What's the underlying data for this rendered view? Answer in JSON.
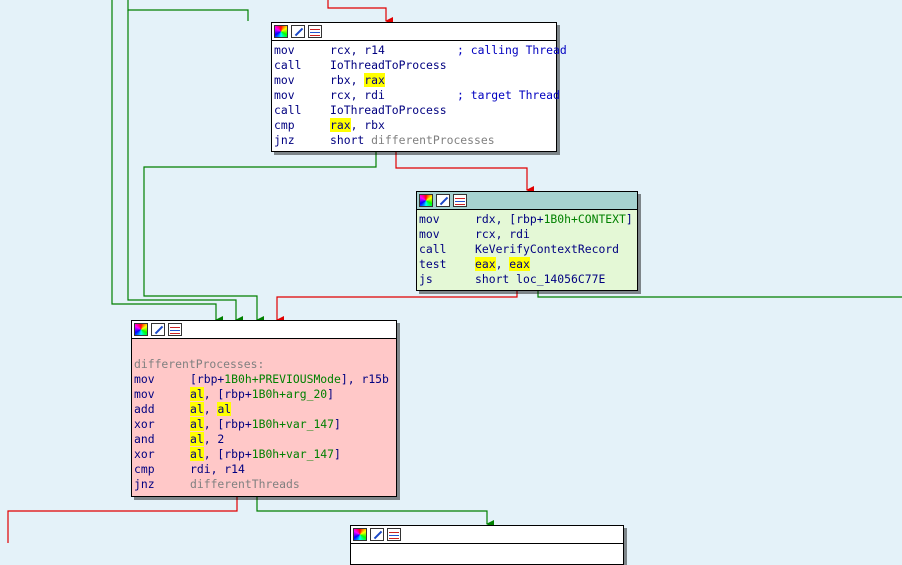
{
  "colors": {
    "background": "#e4f2f9",
    "block_white": "#ffffff",
    "block_green": "#e4f8d6",
    "block_header_green": "#a6d2d0",
    "block_red": "#ffc8c8",
    "edge_true": "#008000",
    "edge_false": "#e00000",
    "highlight": "#ffff00"
  },
  "blocks": {
    "b1": {
      "header_icons": [
        "color-palette-icon",
        "edit-pencil-icon",
        "graph-view-icon"
      ],
      "lines": [
        {
          "mn": "mov",
          "ops": [
            {
              "t": "rcx, r14"
            }
          ],
          "comment": "; calling Thread"
        },
        {
          "mn": "call",
          "ops": [
            {
              "t": "IoThreadToProcess"
            }
          ]
        },
        {
          "mn": "mov",
          "ops": [
            {
              "t": "rbx, "
            },
            {
              "t": "rax",
              "hl": true
            }
          ]
        },
        {
          "mn": "mov",
          "ops": [
            {
              "t": "rcx, rdi"
            }
          ],
          "comment": "; target Thread"
        },
        {
          "mn": "call",
          "ops": [
            {
              "t": "IoThreadToProcess"
            }
          ]
        },
        {
          "mn": "cmp",
          "ops": [
            {
              "t": "rax",
              "hl": true
            },
            {
              "t": ", rbx"
            }
          ]
        },
        {
          "mn": "jnz",
          "ops": [
            {
              "t": "short "
            },
            {
              "t": "differentProcesses",
              "c": "gray"
            }
          ]
        }
      ]
    },
    "b2": {
      "header_icons": [
        "color-palette-icon",
        "edit-pencil-icon",
        "graph-view-icon"
      ],
      "lines": [
        {
          "mn": "mov",
          "ops": [
            {
              "t": "rdx, [rbp+"
            },
            {
              "t": "1B0h+CONTEXT",
              "c": "green"
            },
            {
              "t": "]"
            }
          ]
        },
        {
          "mn": "mov",
          "ops": [
            {
              "t": "rcx, rdi"
            }
          ]
        },
        {
          "mn": "call",
          "ops": [
            {
              "t": "KeVerifyContextRecord"
            }
          ]
        },
        {
          "mn": "test",
          "ops": [
            {
              "t": "eax",
              "hl": true
            },
            {
              "t": ", "
            },
            {
              "t": "eax",
              "hl": true
            }
          ]
        },
        {
          "mn": "js",
          "ops": [
            {
              "t": "short loc_14056C77E"
            }
          ]
        }
      ]
    },
    "b3": {
      "header_icons": [
        "color-palette-icon",
        "edit-pencil-icon",
        "graph-view-icon"
      ],
      "label": "differentProcesses:",
      "lines": [
        {
          "mn": "mov",
          "ops": [
            {
              "t": "[rbp+"
            },
            {
              "t": "1B0h+PREVIOUSMode",
              "c": "green"
            },
            {
              "t": "], r15b"
            }
          ]
        },
        {
          "mn": "mov",
          "ops": [
            {
              "t": "al",
              "hl": true
            },
            {
              "t": ", [rbp+"
            },
            {
              "t": "1B0h+arg_20",
              "c": "green"
            },
            {
              "t": "]"
            }
          ]
        },
        {
          "mn": "add",
          "ops": [
            {
              "t": "al",
              "hl": true
            },
            {
              "t": ", "
            },
            {
              "t": "al",
              "hl": true
            }
          ]
        },
        {
          "mn": "xor",
          "ops": [
            {
              "t": "al",
              "hl": true
            },
            {
              "t": ", [rbp+"
            },
            {
              "t": "1B0h+var_147",
              "c": "green"
            },
            {
              "t": "]"
            }
          ]
        },
        {
          "mn": "and",
          "ops": [
            {
              "t": "al",
              "hl": true
            },
            {
              "t": ", 2"
            }
          ]
        },
        {
          "mn": "xor",
          "ops": [
            {
              "t": "al",
              "hl": true
            },
            {
              "t": ", [rbp+"
            },
            {
              "t": "1B0h+var_147",
              "c": "green"
            },
            {
              "t": "]"
            }
          ]
        },
        {
          "mn": "cmp",
          "ops": [
            {
              "t": "rdi, r14"
            }
          ]
        },
        {
          "mn": "jnz",
          "ops": [
            {
              "t": "differentThreads",
              "c": "gray"
            }
          ]
        }
      ]
    },
    "b4": {
      "header_icons": [
        "color-palette-icon",
        "edit-pencil-icon",
        "graph-view-icon"
      ],
      "lines": []
    }
  }
}
